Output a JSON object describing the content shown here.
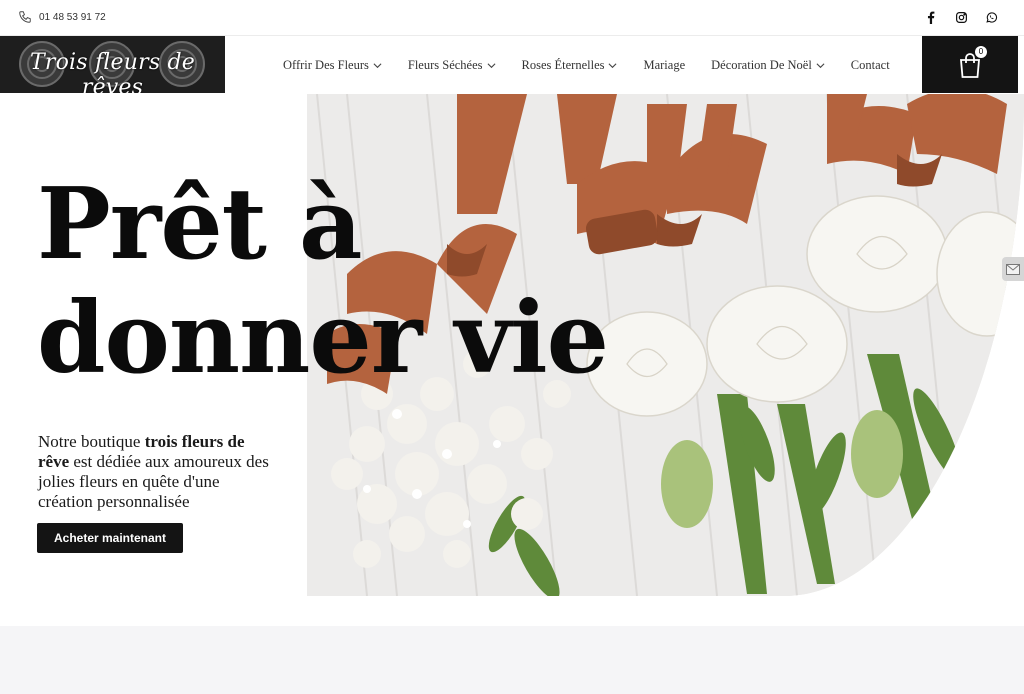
{
  "topbar": {
    "phone": "01 48 53 91 72",
    "phone_icon": "phone-icon",
    "socials": [
      "facebook-icon",
      "instagram-icon",
      "whatsapp-icon"
    ]
  },
  "header": {
    "logo_text": "Trois fleurs de rêves",
    "nav": [
      {
        "label": "Offrir Des Fleurs",
        "has_dropdown": true
      },
      {
        "label": "Fleurs Séchées",
        "has_dropdown": true
      },
      {
        "label": "Roses Éternelles",
        "has_dropdown": true
      },
      {
        "label": "Mariage",
        "has_dropdown": false
      },
      {
        "label": "Décoration De Noël",
        "has_dropdown": true
      },
      {
        "label": "Contact",
        "has_dropdown": false
      }
    ],
    "cart_count": "0",
    "cart_icon": "shopping-bag-icon"
  },
  "hero": {
    "headline_line1": "Prêt à",
    "headline_line2": "donner vie",
    "intro_before": "Notre boutique ",
    "intro_bold": "trois fleurs de rêve",
    "intro_after": " est dédiée aux amoureux des jolies fleurs en quête d'une création personnalisée",
    "cta_label": "Acheter maintenant",
    "image_desc_icon": "bouquet-photo"
  },
  "colors": {
    "dark": "#141414",
    "ribbon": "#b5653f",
    "section_bg": "#f5f5f7"
  }
}
